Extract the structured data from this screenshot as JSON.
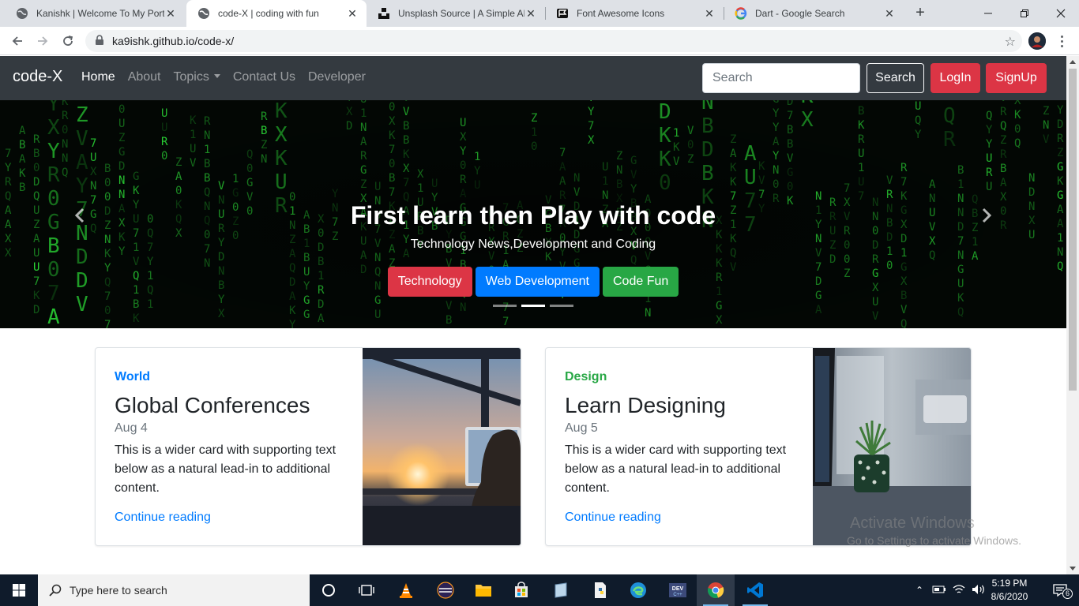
{
  "browser": {
    "tabs": [
      {
        "title": "Kanishk | Welcome To My Portf",
        "active": false
      },
      {
        "title": "code-X | coding with fun",
        "active": true
      },
      {
        "title": "Unsplash Source | A Simple AP",
        "active": false
      },
      {
        "title": "Font Awesome Icons",
        "active": false
      },
      {
        "title": "Dart - Google Search",
        "active": false
      }
    ],
    "url": "ka9ishk.github.io/code-x/"
  },
  "navbar": {
    "brand": "code-X",
    "links": [
      "Home",
      "About",
      "Topics",
      "Contact Us",
      "Developer"
    ],
    "active_link": "Home",
    "search_placeholder": "Search",
    "search_button": "Search",
    "login_button": "LogIn",
    "signup_button": "SignUp"
  },
  "hero": {
    "title": "First learn then Play with code",
    "subtitle": "Technology News,Development and Coding",
    "buttons": [
      "Technology",
      "Web Development",
      "Code Fun"
    ],
    "slide_count": 3,
    "active_slide": 2
  },
  "cards": [
    {
      "category": "World",
      "category_color": "#007bff",
      "title": "Global Conferences",
      "date": "Aug 4",
      "text": "This is a wider card with supporting text below as a natural lead-in to additional content.",
      "link": "Continue reading"
    },
    {
      "category": "Design",
      "category_color": "#28a745",
      "title": "Learn Designing",
      "date": "Aug 5",
      "text": "This is a wider card with supporting text below as a natural lead-in to additional content.",
      "link": "Continue reading"
    }
  ],
  "watermark": {
    "line1": "Activate Windows",
    "line2": "Go to Settings to activate Windows."
  },
  "taskbar": {
    "search_placeholder": "Type here to search",
    "time": "5:19 PM",
    "date": "8/6/2020",
    "notification_count": "6"
  },
  "colors": {
    "navbar_bg": "#343a40",
    "danger": "#dc3545",
    "primary": "#007bff",
    "success": "#28a745"
  }
}
